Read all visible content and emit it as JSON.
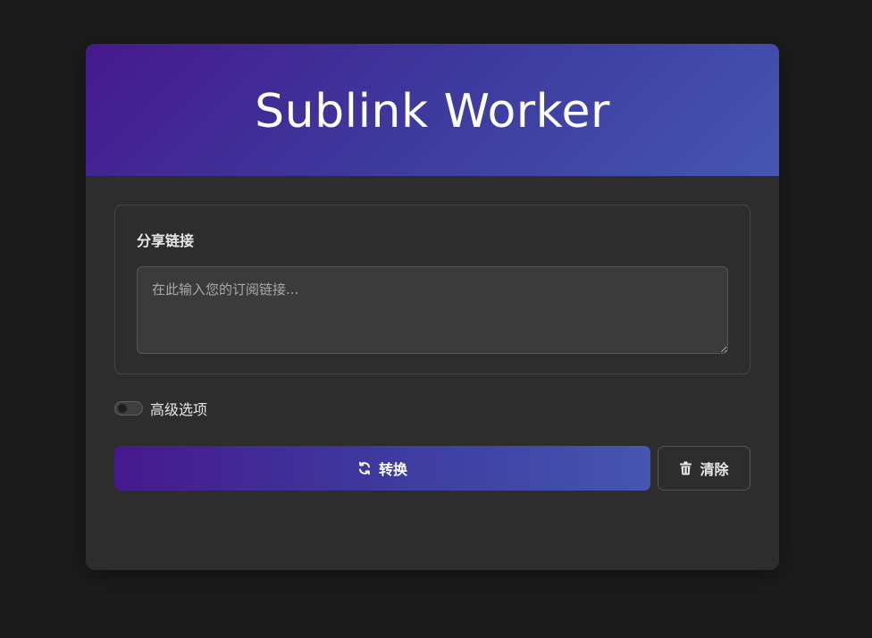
{
  "header": {
    "title": "Sublink Worker"
  },
  "share_link": {
    "label": "分享链接",
    "input_value": "",
    "placeholder": "在此输入您的订阅链接..."
  },
  "advanced": {
    "label": "高级选项",
    "enabled": false
  },
  "actions": {
    "convert_label": "转换",
    "convert_icon": "sync-icon",
    "clear_label": "清除",
    "clear_icon": "trash-icon"
  },
  "colors": {
    "page_bg": "#1b1b1b",
    "card_bg": "#2d2d2d",
    "gradient_start": "#46198c",
    "gradient_end": "#4556b0",
    "text": "#e6e6e6"
  }
}
